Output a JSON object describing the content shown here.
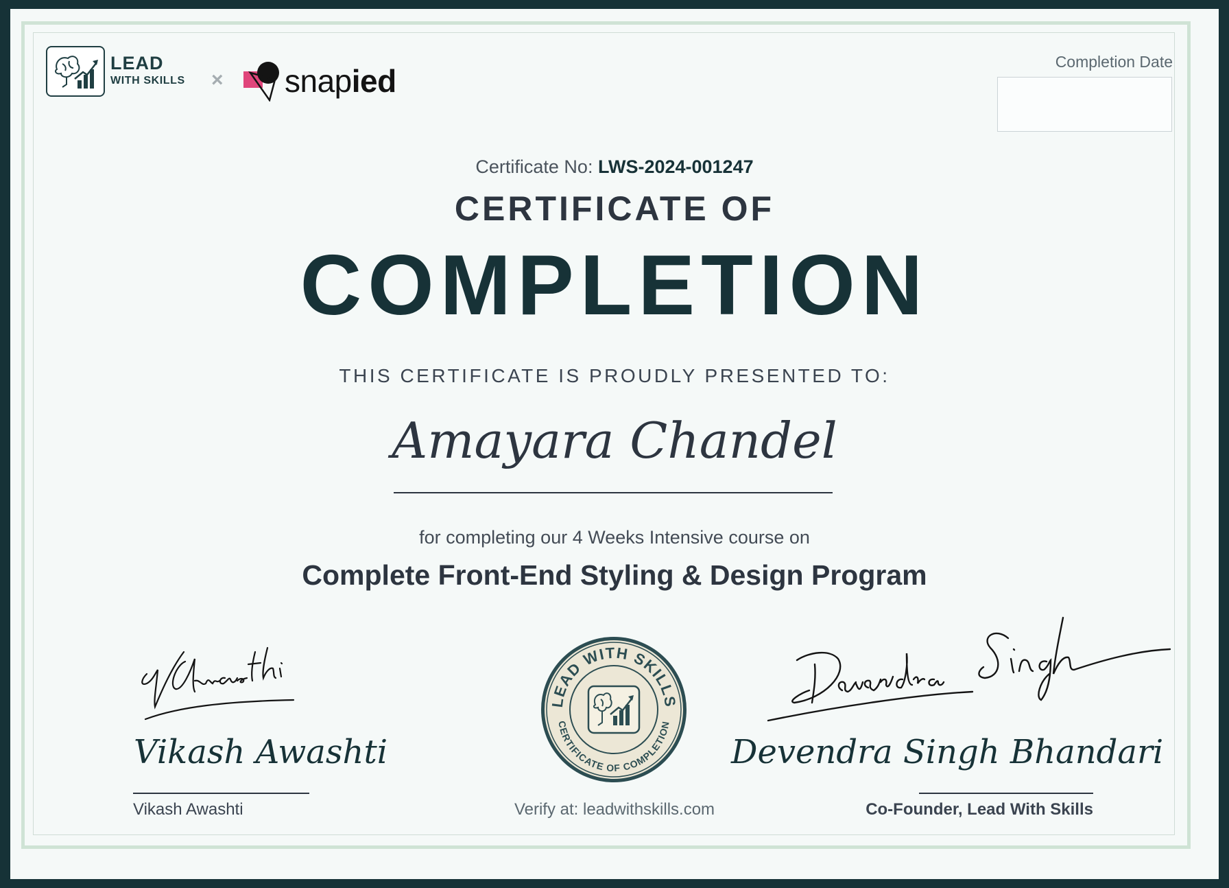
{
  "branding": {
    "lws_line1": "LEAD",
    "lws_line2": "WITH SKILLS",
    "separator": "×",
    "partner_regular": "snap",
    "partner_bold": "ied",
    "lws_icon": "brain-growth-chart-icon",
    "snap_icon": "snapied-mark-icon",
    "accent_pink": "#e0457b"
  },
  "completion_date": {
    "label": "Completion Date",
    "value": ""
  },
  "certificate": {
    "number_label": "Certificate No:",
    "number": "LWS-2024-001247",
    "heading_small": "CERTIFICATE OF",
    "heading_large": "COMPLETION",
    "presented_to": "THIS CERTIFICATE IS PROUDLY PRESENTED TO:",
    "recipient": "Amayara Chandel",
    "course_intro": "for completing our 4 Weeks Intensive course on",
    "course_title": "Complete Front-End Styling & Design Program"
  },
  "signatories": {
    "left": {
      "signature": "VAwasthi",
      "name_script": "Vikash Awashti",
      "label": "Vikash Awashti"
    },
    "right": {
      "signature": "Devendra Singh",
      "name_script": "Devendra Singh Bhandari",
      "label": "Co-Founder, Lead With Skills"
    }
  },
  "seal": {
    "top_text": "LEAD WITH SKILLS",
    "bottom_text": "CERTIFICATE OF COMPLETION",
    "icon": "brain-growth-chart-icon"
  },
  "verify": "Verify at: leadwithskills.com",
  "colors": {
    "dark_teal": "#163237",
    "frame_green": "#cfe3d5",
    "paper": "#f5f9f8"
  }
}
